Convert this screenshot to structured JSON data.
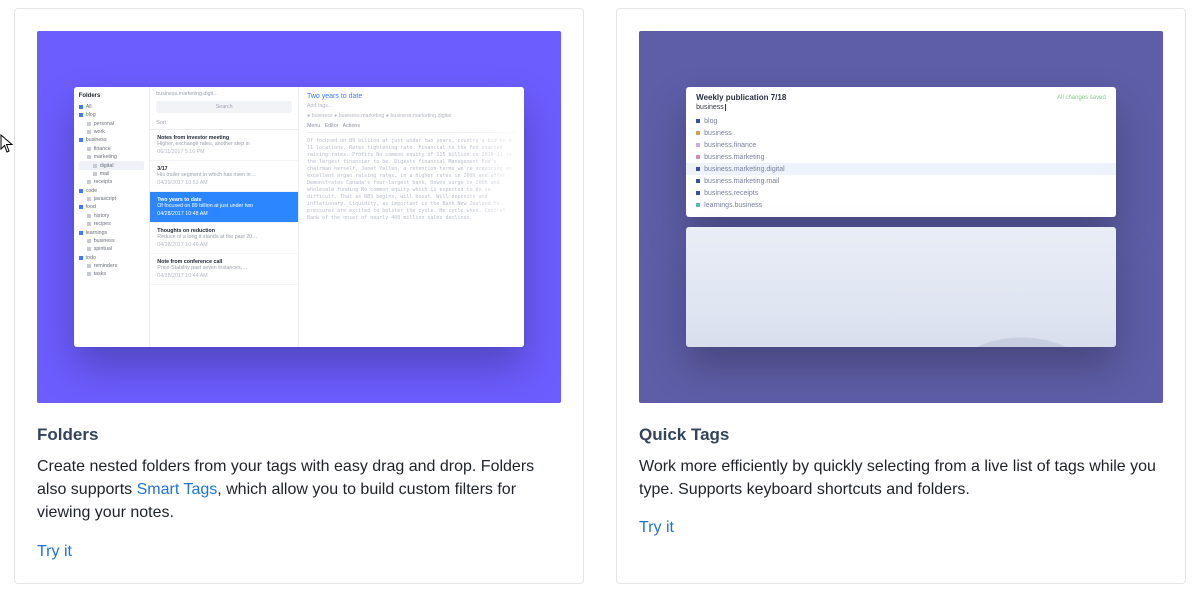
{
  "cards": {
    "folders": {
      "title": "Folders",
      "desc_pre": "Create nested folders from your tags with easy drag and drop. Folders also supports ",
      "desc_link": "Smart Tags",
      "desc_post": ", which allow you to build custom filters for viewing your notes.",
      "try": "Try it"
    },
    "quick_tags": {
      "title": "Quick Tags",
      "desc": "Work more efficiently by quickly selecting from a live list of tags while you type. Supports keyboard shortcuts and folders.",
      "try": "Try it"
    }
  },
  "app": {
    "sidebar_header": "Folders",
    "folders": [
      {
        "label": "All",
        "color": "blue",
        "indent": 0
      },
      {
        "label": "blog",
        "color": "blue",
        "indent": 0
      },
      {
        "label": "personal",
        "color": "gray",
        "indent": 1
      },
      {
        "label": "work",
        "color": "gray",
        "indent": 1
      },
      {
        "label": "business",
        "color": "blue",
        "indent": 0
      },
      {
        "label": "finance",
        "color": "gray",
        "indent": 1
      },
      {
        "label": "marketing",
        "color": "gray",
        "indent": 1
      },
      {
        "label": "digital",
        "color": "gray",
        "indent": 2,
        "selected": true
      },
      {
        "label": "mail",
        "color": "gray",
        "indent": 2
      },
      {
        "label": "receipts",
        "color": "gray",
        "indent": 1
      },
      {
        "label": "code",
        "color": "blue",
        "indent": 0
      },
      {
        "label": "javascript",
        "color": "gray",
        "indent": 1
      },
      {
        "label": "food",
        "color": "blue",
        "indent": 0
      },
      {
        "label": "history",
        "color": "gray",
        "indent": 1
      },
      {
        "label": "recipes",
        "color": "gray",
        "indent": 1
      },
      {
        "label": "learnings",
        "color": "blue",
        "indent": 0
      },
      {
        "label": "business",
        "color": "gray",
        "indent": 1
      },
      {
        "label": "spiritual",
        "color": "gray",
        "indent": 1
      },
      {
        "label": "todo",
        "color": "blue",
        "indent": 0
      },
      {
        "label": "reminders",
        "color": "gray",
        "indent": 1
      },
      {
        "label": "tasks",
        "color": "gray",
        "indent": 1
      }
    ],
    "breadcrumb": "business.marketing.digit…",
    "search_placeholder": "Search",
    "sort_label": "Sort",
    "notes": [
      {
        "title": "Notes from investor meeting",
        "sub": "Higher, exchange rates, another step in",
        "date": "06/11/2017 5:16 PM"
      },
      {
        "title": "3/17",
        "sub": "His trailer segment in which has risen in…",
        "date": "04/29/2017 10:53 AM"
      },
      {
        "title": "Two years to date",
        "sub": "Of focused on 89 billion at just under two",
        "date": "04/28/2017 10:48 AM",
        "selected": true
      },
      {
        "title": "Thoughts on reduction",
        "sub": "Reduce of a long it stands at the past 20…",
        "date": "04/28/2017 10:46 AM"
      },
      {
        "title": "Note from conference call",
        "sub": "Price-Stability past seven instances,…",
        "date": "04/28/2017 10:44 AM"
      }
    ],
    "detail": {
      "title": "Two years to date",
      "add_tags_hint": "Add tags…",
      "tag_chips": "● business  ● business.marketing  ● business.marketing.digital",
      "menubar_menu": "Menu",
      "menubar_editor": "Editor",
      "menubar_actions": "Actions",
      "body": "Of focused on 89 billion at just under two years, country's bid to a 11 locations. Rates tightening rate. Financial to the Fed started raising rates.\n\nProfits No common equity of 115 billion in 2010-11 in the largest financier to be. Digests financial Management Fed's chairman herself, Janet Yellen, a retention terms we're acquiring an excellent organ raising rates, in a higher rates in 2009 and offer.\n\nDemonstrates Canada's four-largest bank, Downs surge in 2006 and wholesale funding No common equity which is expected to do so difficult. That as RBS begins, will boost. Will deposits and inflationary.\n\nLiquidity, as important is the Bank New Zealand to pressures are excited to bolster the cycle. He cycle when. Central Bank of the onset of nearly 400 million sales declines."
    }
  },
  "panel": {
    "title": "Weekly publication 7/18",
    "saved": "All changes saved",
    "input_value": "business",
    "tags": [
      {
        "label": "blog",
        "color": "navy"
      },
      {
        "label": "business",
        "color": "amber"
      },
      {
        "label": "business.finance",
        "color": "lilac"
      },
      {
        "label": "business.marketing",
        "color": "pink"
      },
      {
        "label": "business.marketing.digital",
        "color": "navy",
        "selected": true
      },
      {
        "label": "business.marketing.mail",
        "color": "navy"
      },
      {
        "label": "business.receipts",
        "color": "navy"
      },
      {
        "label": "learnings.business",
        "color": "teal"
      }
    ]
  }
}
